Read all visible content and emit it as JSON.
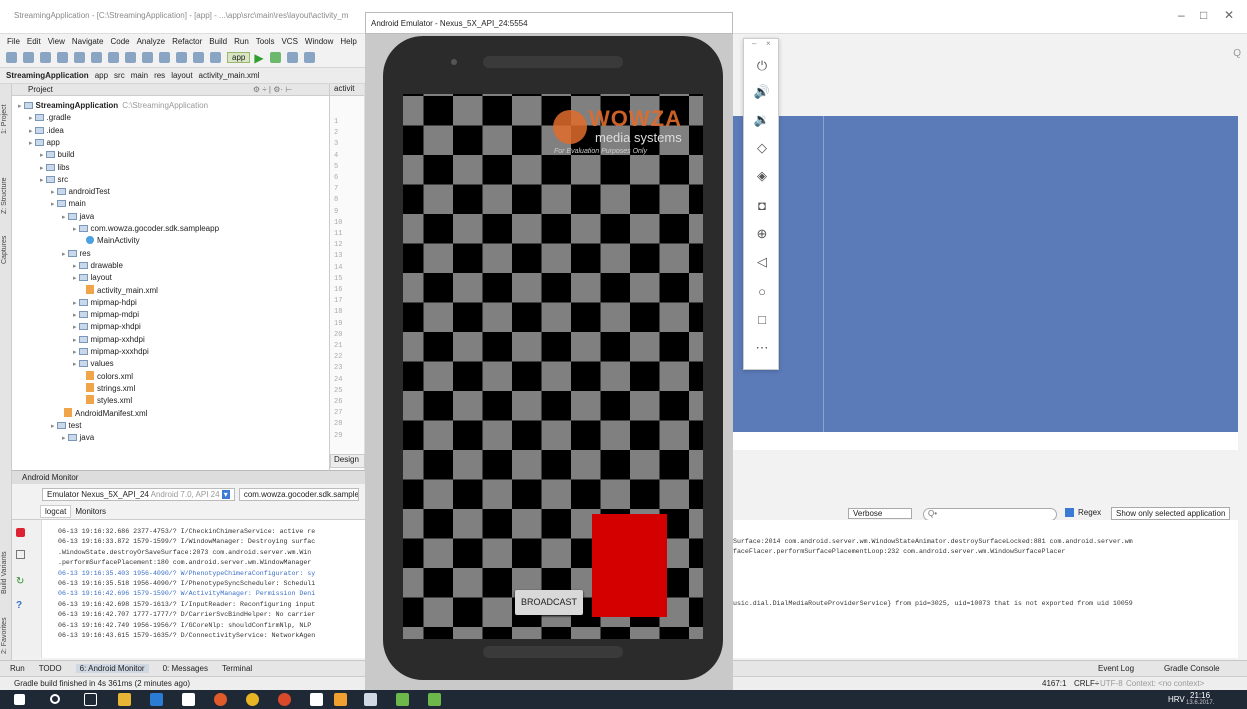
{
  "window": {
    "title": "StreamingApplication - [C:\\StreamingApplication] - [app] - ...\\app\\src\\main\\res\\layout\\activity_m",
    "minimize": "–",
    "maximize": "□",
    "close": "✕"
  },
  "menu": [
    "File",
    "Edit",
    "View",
    "Navigate",
    "Code",
    "Analyze",
    "Refactor",
    "Build",
    "Run",
    "Tools",
    "VCS",
    "Window",
    "Help"
  ],
  "breadcrumbs": [
    "StreamingApplication",
    "app",
    "src",
    "main",
    "res",
    "layout",
    "activity_main.xml"
  ],
  "toolbar": {
    "run_config": "app"
  },
  "project_panel": {
    "title": "Project",
    "sidebar": [
      "1: Project",
      "Z: Structure",
      "Captures",
      "Build Variants",
      "2: Favorites"
    ],
    "tree": [
      {
        "label": "StreamingApplication",
        "extra": "C:\\StreamingApplication",
        "depth": 0,
        "icon": "folder"
      },
      {
        "label": ".gradle",
        "depth": 1,
        "icon": "folder"
      },
      {
        "label": ".idea",
        "depth": 1,
        "icon": "folder"
      },
      {
        "label": "app",
        "depth": 1,
        "icon": "folder"
      },
      {
        "label": "build",
        "depth": 2,
        "icon": "folder"
      },
      {
        "label": "libs",
        "depth": 2,
        "icon": "folder"
      },
      {
        "label": "src",
        "depth": 2,
        "icon": "folder"
      },
      {
        "label": "androidTest",
        "depth": 3,
        "icon": "folder"
      },
      {
        "label": "main",
        "depth": 3,
        "icon": "folder"
      },
      {
        "label": "java",
        "depth": 4,
        "icon": "folder"
      },
      {
        "label": "com.wowza.gocoder.sdk.sampleapp",
        "depth": 5,
        "icon": "folder"
      },
      {
        "label": "MainActivity",
        "depth": 6,
        "icon": "class"
      },
      {
        "label": "res",
        "depth": 4,
        "icon": "folder"
      },
      {
        "label": "drawable",
        "depth": 5,
        "icon": "folder"
      },
      {
        "label": "layout",
        "depth": 5,
        "icon": "folder"
      },
      {
        "label": "activity_main.xml",
        "depth": 6,
        "icon": "xml"
      },
      {
        "label": "mipmap-hdpi",
        "depth": 5,
        "icon": "folder"
      },
      {
        "label": "mipmap-mdpi",
        "depth": 5,
        "icon": "folder"
      },
      {
        "label": "mipmap-xhdpi",
        "depth": 5,
        "icon": "folder"
      },
      {
        "label": "mipmap-xxhdpi",
        "depth": 5,
        "icon": "folder"
      },
      {
        "label": "mipmap-xxxhdpi",
        "depth": 5,
        "icon": "folder"
      },
      {
        "label": "values",
        "depth": 5,
        "icon": "folder"
      },
      {
        "label": "colors.xml",
        "depth": 6,
        "icon": "xml"
      },
      {
        "label": "strings.xml",
        "depth": 6,
        "icon": "xml"
      },
      {
        "label": "styles.xml",
        "depth": 6,
        "icon": "xml"
      },
      {
        "label": "AndroidManifest.xml",
        "depth": 4,
        "icon": "xml"
      },
      {
        "label": "test",
        "depth": 3,
        "icon": "folder"
      },
      {
        "label": "java",
        "depth": 4,
        "icon": "folder"
      }
    ]
  },
  "editor": {
    "tab": "activit",
    "line_numbers": [
      "1",
      "2",
      "3",
      "4",
      "5",
      "6",
      "7",
      "8",
      "9",
      "10",
      "11",
      "12",
      "13",
      "14",
      "15",
      "16",
      "17",
      "18",
      "19",
      "20",
      "21",
      "22",
      "23",
      "24",
      "25",
      "26",
      "27",
      "28",
      "29"
    ],
    "design_tab": "Design"
  },
  "monitor": {
    "title": "Android Monitor",
    "device": "Emulator Nexus_5X_API_24",
    "device_version": "Android 7.0, API 24",
    "process": "com.wowza.gocoder.sdk.sampleap",
    "tabs": [
      "logcat",
      "Monitors"
    ],
    "filter": {
      "level": "Verbose",
      "search_placeholder": "Q•",
      "regex_label": "Regex",
      "show_only": "Show only selected application"
    },
    "log_left": [
      "06-13 19:16:32.686 2377-4753/? I/CheckinChimeraService: active re",
      "06-13 19:16:33.872 1579-1599/? I/WindowManager: Destroying surfac",
      "   .WindowState.destroyOrSaveSurface:2073 com.android.server.wm.Win",
      "   .performSurfacePlacement:180 com.android.server.wm.WindowManager",
      "06-13 19:16:35.403 1956-4090/? W/PhenotypeChimeraConfigurator: sy",
      "06-13 19:16:35.518 1956-4090/? I/PhenotypeSyncScheduler: Scheduli",
      "06-13 19:16:42.696 1579-1590/? W/ActivityManager: Permission Deni",
      "06-13 19:16:42.698 1579-1613/? I/InputReader: Reconfiguring input",
      "06-13 19:16:42.707 1777-1777/? D/CarrierSvcBindHelper: No carrier",
      "06-13 19:16:42.749 1956-1956/? I/GCoreNlp: shouldConfirmNlp, NLP ",
      "06-13 19:16:43.615 1579-1635/? D/ConnectivityService: NetworkAgen"
    ],
    "log_right": [
      "Surface:2014 com.android.server.wm.WindowStateAnimator.destroySurfaceLocked:881 com.android.server.wm",
      "faceFlacer.performSurfacePlacementLoop:232 com.android.server.wm.WindowSurfacePlacer",
      "",
      "",
      "",
      "",
      "usic.dial.DialMediaRouteProviderService} from pid=3025, uid=10073 that is not exported from uid 10059"
    ]
  },
  "bottom_tabs": [
    "Run",
    "TODO",
    "6: Android Monitor",
    "0: Messages",
    "Terminal"
  ],
  "bottom_right_tabs": [
    "Event Log",
    "Gradle Console"
  ],
  "status": {
    "message": "Gradle build finished in 4s 361ms (2 minutes ago)",
    "position": "4167:1",
    "line_sep": "CRLF÷",
    "encoding": "UTF-8",
    "context": "Context: <no context>"
  },
  "emulator": {
    "title": "Android Emulator - Nexus_5X_API_24:5554",
    "close": "×",
    "minimize": "–",
    "watermark": {
      "brand": "WOWZA",
      "sub": "media systems",
      "note": "For Evaluation Purposes Only",
      "tm": "™"
    },
    "broadcast_button": "BROADCAST"
  },
  "taskbar": {
    "lang": "HRV",
    "time": "21:16",
    "date": "13.6.2017."
  }
}
